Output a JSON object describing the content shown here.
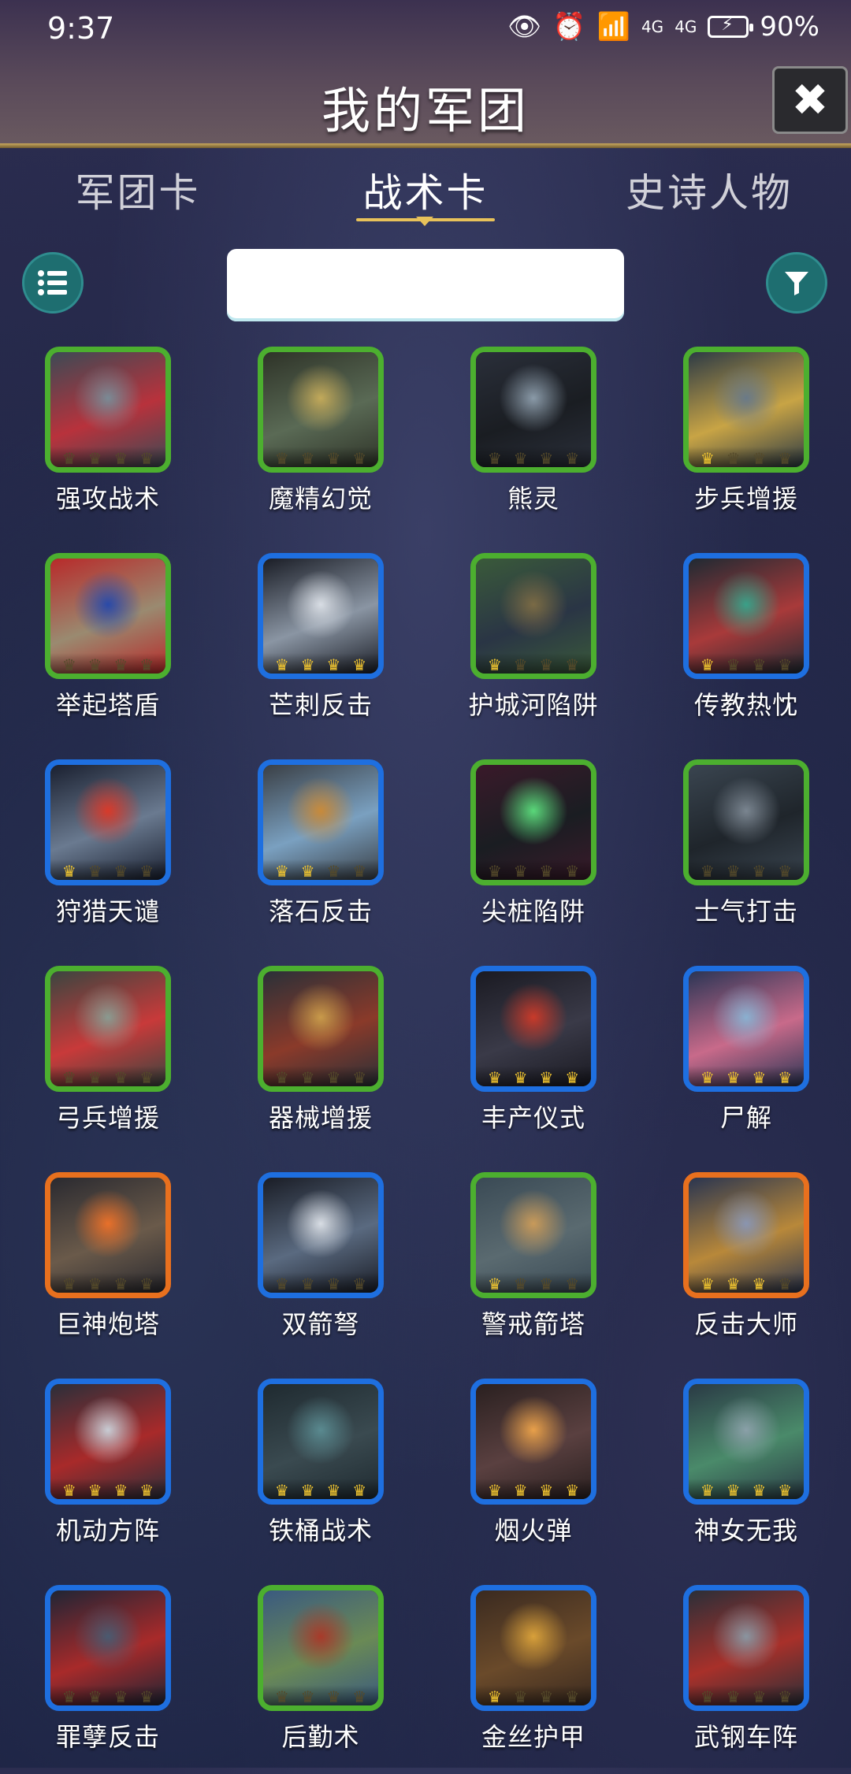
{
  "status_bar": {
    "time": "9:37",
    "eye_icon": "👁",
    "alarm_icon": "⏰",
    "wifi_icon": "📶",
    "signal_1": "4G",
    "signal_2": "4G",
    "battery": "90%"
  },
  "header": {
    "title": "我的军团",
    "close_label": "✖"
  },
  "tabs": [
    {
      "label": "军团卡"
    },
    {
      "label": "战术卡"
    },
    {
      "label": "史诗人物"
    }
  ],
  "search": {
    "value": "",
    "placeholder": ""
  },
  "cards": [
    {
      "name": "强攻战术",
      "frame": "green",
      "crowns": 0,
      "colors": [
        "#3c4a55",
        "#7a8a95",
        "#b8323c"
      ]
    },
    {
      "name": "魔精幻觉",
      "frame": "green",
      "crowns": 0,
      "colors": [
        "#2e3328",
        "#c2a95a",
        "#5a6a55"
      ]
    },
    {
      "name": "熊灵",
      "frame": "green",
      "crowns": 0,
      "colors": [
        "#2a2f3a",
        "#8a9aa8",
        "#1a1d22"
      ]
    },
    {
      "name": "步兵增援",
      "frame": "green",
      "crowns": 1,
      "colors": [
        "#2c3a45",
        "#6a7a88",
        "#c8a445"
      ]
    },
    {
      "name": "举起塔盾",
      "frame": "green",
      "crowns": 0,
      "colors": [
        "#b82a2a",
        "#2a4aa8",
        "#9a8a70"
      ]
    },
    {
      "name": "芒刺反击",
      "frame": "blue",
      "crowns": 4,
      "colors": [
        "#1a1d26",
        "#d8dde4",
        "#8a95a3"
      ]
    },
    {
      "name": "护城河陷阱",
      "frame": "green",
      "crowns": 1,
      "colors": [
        "#3a5a3a",
        "#7a6a45",
        "#2a3545"
      ]
    },
    {
      "name": "传教热忱",
      "frame": "blue",
      "crowns": 1,
      "colors": [
        "#1f2a33",
        "#3aa088",
        "#a83a3a"
      ]
    },
    {
      "name": "狩猎天谴",
      "frame": "blue",
      "crowns": 1,
      "colors": [
        "#1a2030",
        "#d83a2a",
        "#6a7a90"
      ]
    },
    {
      "name": "落石反击",
      "frame": "blue",
      "crowns": 2,
      "colors": [
        "#3a3f45",
        "#c88a3a",
        "#7aa0c0"
      ]
    },
    {
      "name": "尖桩陷阱",
      "frame": "green",
      "crowns": 0,
      "colors": [
        "#3a1a2a",
        "#5ad87a",
        "#1a1d22"
      ]
    },
    {
      "name": "士气打击",
      "frame": "green",
      "crowns": 0,
      "colors": [
        "#3a4550",
        "#7a8590",
        "#1f252b"
      ]
    },
    {
      "name": "弓兵增援",
      "frame": "green",
      "crowns": 0,
      "colors": [
        "#3a4540",
        "#8a9a90",
        "#c83a3a"
      ]
    },
    {
      "name": "器械增援",
      "frame": "green",
      "crowns": 0,
      "colors": [
        "#2a3038",
        "#c89a4a",
        "#8a3a2a"
      ]
    },
    {
      "name": "丰产仪式",
      "frame": "blue",
      "crowns": 4,
      "colors": [
        "#1a1a22",
        "#c83a2a",
        "#3a3a48"
      ]
    },
    {
      "name": "尸解",
      "frame": "blue",
      "crowns": 4,
      "colors": [
        "#2a3555",
        "#8ab0d0",
        "#c86a8a"
      ]
    },
    {
      "name": "巨神炮塔",
      "frame": "orange",
      "crowns": 0,
      "colors": [
        "#2a2a30",
        "#e8702a",
        "#6a5a4a"
      ]
    },
    {
      "name": "双箭弩",
      "frame": "blue",
      "crowns": 0,
      "colors": [
        "#1a1d26",
        "#d8dde4",
        "#5a6a80"
      ]
    },
    {
      "name": "警戒箭塔",
      "frame": "green",
      "crowns": 1,
      "colors": [
        "#3a4a55",
        "#c89a5a",
        "#5a6a70"
      ]
    },
    {
      "name": "反击大师",
      "frame": "orange",
      "crowns": 3,
      "colors": [
        "#2a3550",
        "#8a95b0",
        "#b8883a"
      ]
    },
    {
      "name": "机动方阵",
      "frame": "blue",
      "crowns": 4,
      "colors": [
        "#2a2f3a",
        "#c8ccd4",
        "#a82a2a"
      ]
    },
    {
      "name": "铁桶战术",
      "frame": "blue",
      "crowns": 4,
      "colors": [
        "#1f2a30",
        "#5a8a90",
        "#3a4a50"
      ]
    },
    {
      "name": "烟火弹",
      "frame": "blue",
      "crowns": 4,
      "colors": [
        "#2a2020",
        "#e8a04a",
        "#5a4040"
      ]
    },
    {
      "name": "神女无我",
      "frame": "blue",
      "crowns": 4,
      "colors": [
        "#2a3a45",
        "#8aa0a8",
        "#4a8a6a"
      ]
    },
    {
      "name": "罪孽反击",
      "frame": "blue",
      "crowns": 0,
      "colors": [
        "#1f2535",
        "#4a5a70",
        "#a82a2a"
      ]
    },
    {
      "name": "后勤术",
      "frame": "green",
      "crowns": 0,
      "colors": [
        "#3a5a80",
        "#a83a2a",
        "#6a8a55"
      ]
    },
    {
      "name": "金丝护甲",
      "frame": "blue",
      "crowns": 1,
      "colors": [
        "#3a2a20",
        "#d8a03a",
        "#6a4a2a"
      ]
    },
    {
      "name": "武钢车阵",
      "frame": "blue",
      "crowns": 0,
      "colors": [
        "#2a2f38",
        "#8a95a0",
        "#a8302a"
      ]
    }
  ],
  "theme": {
    "frame_green": "#4caf2f",
    "frame_blue": "#1e6fe0",
    "frame_orange": "#e8701e",
    "crown_lit": "#f2c630",
    "accent_gold": "#e8c25a",
    "button_teal": "#1e6e70"
  }
}
